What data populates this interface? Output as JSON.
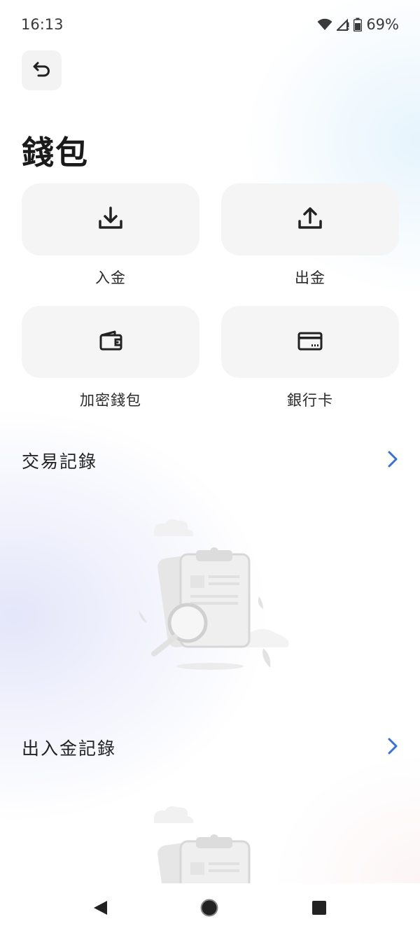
{
  "status_bar": {
    "time": "16:13",
    "battery": "69%",
    "icons": [
      "wifi-icon",
      "cellular-signal-icon",
      "battery-icon"
    ]
  },
  "header": {
    "back_icon": "undo-back-icon",
    "title": "錢包"
  },
  "actions": [
    {
      "label": "入金",
      "icon": "download-icon"
    },
    {
      "label": "出金",
      "icon": "upload-icon"
    },
    {
      "label": "加密錢包",
      "icon": "wallet-icon"
    },
    {
      "label": "銀行卡",
      "icon": "credit-card-icon"
    }
  ],
  "sections": {
    "transactions": {
      "title": "交易記錄",
      "chevron_icon": "chevron-right-icon"
    },
    "deposit_withdraw": {
      "title": "出入金記錄",
      "chevron_icon": "chevron-right-icon"
    }
  },
  "colors": {
    "accent": "#3a6fd8",
    "tile_bg": "#f5f5f5",
    "text": "#1f1f1f"
  },
  "nav_bar": {
    "buttons": [
      "back-triangle-icon",
      "home-circle-icon",
      "recents-square-icon"
    ]
  }
}
